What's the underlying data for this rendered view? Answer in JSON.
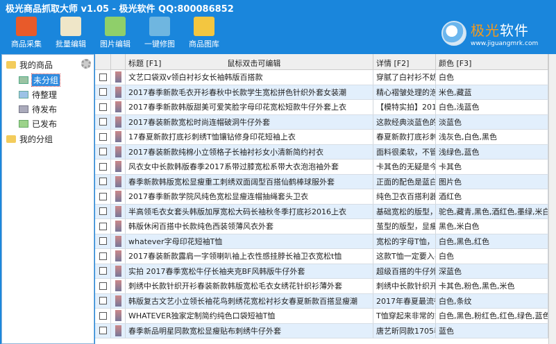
{
  "window": {
    "title": "极光商品抓取大师 v1.05 - 极光软件 QQ:800086852"
  },
  "toolbar": [
    {
      "label": "商品采集",
      "icon": "magnet-icon",
      "color": "#e85a2a"
    },
    {
      "label": "批量编辑",
      "icon": "document-edit-icon",
      "color": "#efe6c8"
    },
    {
      "label": "图片编辑",
      "icon": "picture-icon",
      "color": "#8fcf6a"
    },
    {
      "label": "一键修图",
      "icon": "picture-repair-icon",
      "color": "#6fb6e0"
    },
    {
      "label": "商品图库",
      "icon": "gallery-folder-icon",
      "color": "#f3c640"
    }
  ],
  "logo": {
    "name_orange": "极光",
    "name_white": "软件",
    "url": "www.jiguangmrk.com"
  },
  "tree": {
    "root": "我的商品",
    "children": [
      "未分组",
      "待整理",
      "待发布",
      "已发布"
    ],
    "selected": "未分组",
    "group": "我的分组"
  },
  "table": {
    "headers": {
      "title": "标题 [F1]",
      "hint": "鼠标双击可编辑",
      "detail": "详情 [F2]",
      "color": "颜色 [F3]"
    },
    "rows": [
      {
        "title": "文艺口袋双v领白衬衫女长袖韩版百搭款",
        "detail": "穿腻了白衬衫不妨",
        "color": "白色"
      },
      {
        "title": "2017春季新款毛衣开衫春秋中长款学生宽松拼色针织外套女装潮",
        "detail": "精心褶皱处理的泡",
        "color": "米色,藏蓝"
      },
      {
        "title": "2017春季新款韩版甜美可爱笑脸字母印花宽松短款牛仔外套上衣",
        "detail": "【模特实拍】201",
        "color": "白色,浅蓝色"
      },
      {
        "title": "2017春装新款宽松时尚连帽破洞牛仔外套",
        "detail": "这款经典淡蓝色的",
        "color": "淡蓝色"
      },
      {
        "title": "17春夏新款打底衫刺绣T恤镶钻修身印花短袖上衣",
        "detail": "春夏新款打底衫刺",
        "color": "浅灰色,白色,黑色"
      },
      {
        "title": "2017春装新款纯棉小立领格子长袖衬衫女小清新简约衬衣",
        "detail": "面料很柔软，不管",
        "color": "浅绿色,蓝色"
      },
      {
        "title": "风衣女中长款韩版春季2017系带过膝宽松系带大衣泡泡袖外套",
        "detail": "卡其色的无疑是今",
        "color": "卡其色"
      },
      {
        "title": "春季新款韩版宽松显瘦重工刺绣双面阔型百搭仙鹤棒球服外套",
        "detail": "正面的配色是蓝白",
        "color": "图片色"
      },
      {
        "title": "2017春季新款学院风纯色宽松显瘦连帽抽绳套头卫衣",
        "detail": "纯色卫衣百搭利器",
        "color": "酒红色"
      },
      {
        "title": "半高领毛衣女套头韩版加厚宽松大码长袖秋冬季打底衫2016上衣",
        "detail": "基础宽松的版型，",
        "color": "驼色,藏青,黑色,酒红色,墨绿,米白色"
      },
      {
        "title": "韩版休闲百搭中长款纯色西装领薄风衣外套",
        "detail": "茧型的版型，显瘦",
        "color": "黑色,米白色"
      },
      {
        "title": "whatever字母印花短袖T恤",
        "detail": "宽松的字母T恤，当",
        "color": "白色,黑色,红色"
      },
      {
        "title": "2017春装新款露肩一字领喇叭袖上衣性感挂脖长袖卫衣宽松t恤",
        "detail": "这款T恤一定要入手",
        "color": "白色"
      },
      {
        "title": "实拍 2017春季宽松牛仔长袖夹克BF风韩版牛仔外套",
        "detail": "超级百搭的牛仔外",
        "color": "深蓝色"
      },
      {
        "title": "刺绣中长款针织开衫春装新款韩版宽松毛衣女绣花针织衫薄外套",
        "detail": "刺绣中长款针织开",
        "color": "卡其色,粉色,黑色,米色"
      },
      {
        "title": "韩版复古文艺小立领长袖花鸟刺绣花宽松衬衫女春夏新款百搭显瘦潮",
        "detail": "2017年春夏最流行",
        "color": "白色,条纹"
      },
      {
        "title": "WHATEVER独家定制简约纯色口袋短袖T恤",
        "detail": "T恤穿起来非常的舒",
        "color": "白色,黑色,粉红色,红色,绿色,蓝色"
      },
      {
        "title": "春季新品明星同款宽松显瘦贴布刺绣牛仔外套",
        "detail": "唐艺昕同款1705春",
        "color": "蓝色"
      }
    ]
  }
}
